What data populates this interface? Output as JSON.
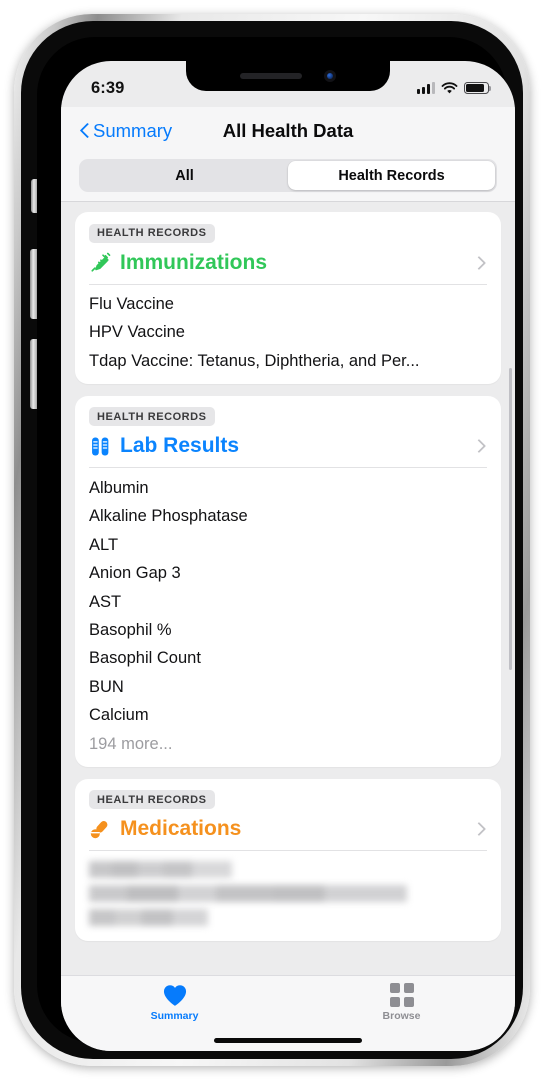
{
  "status_bar": {
    "time": "6:39",
    "signal_icon": "cellular-bars-icon",
    "wifi_icon": "wifi-icon",
    "battery_icon": "battery-icon"
  },
  "nav": {
    "back_label": "Summary",
    "back_icon": "chevron-left-icon",
    "title": "All Health Data"
  },
  "segmented": {
    "options": [
      {
        "label": "All",
        "selected": false
      },
      {
        "label": "Health Records",
        "selected": true
      }
    ]
  },
  "cards": [
    {
      "badge": "HEALTH RECORDS",
      "title": "Immunizations",
      "icon": "syringe-icon",
      "color": "#31c759",
      "rows": [
        "Flu Vaccine",
        "HPV Vaccine",
        "Tdap Vaccine: Tetanus, Diphtheria, and Per..."
      ],
      "more": null,
      "redacted": false
    },
    {
      "badge": "HEALTH RECORDS",
      "title": "Lab Results",
      "icon": "test-tubes-icon",
      "color": "#0b84fe",
      "rows": [
        "Albumin",
        "Alkaline Phosphatase",
        "ALT",
        "Anion Gap 3",
        "AST",
        "Basophil %",
        "Basophil Count",
        "BUN",
        "Calcium"
      ],
      "more": "194 more...",
      "redacted": false
    },
    {
      "badge": "HEALTH RECORDS",
      "title": "Medications",
      "icon": "pills-icon",
      "color": "#f5911e",
      "rows": [],
      "more": null,
      "redacted": true
    }
  ],
  "tabs": [
    {
      "label": "Summary",
      "icon": "heart-icon",
      "active": true
    },
    {
      "label": "Browse",
      "icon": "grid-icon",
      "active": false
    }
  ]
}
